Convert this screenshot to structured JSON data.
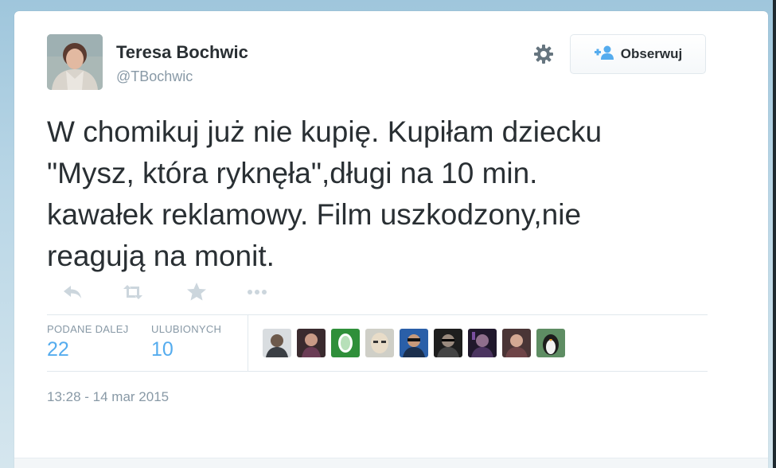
{
  "tweet": {
    "author_name": "Teresa Bochwic",
    "author_handle": "@TBochwic",
    "text_lines": [
      "W chomikuj już nie kupię. Kupiłam dziecku",
      "\"Mysz, która ryknęła\",długi na 10 min.",
      "kawałek reklamowy. Film uszkodzony,nie",
      "reagują na monit."
    ],
    "timestamp": "13:28 - 14 mar 2015"
  },
  "header": {
    "follow_label": "Obserwuj",
    "settings_icon": "gear-icon",
    "follow_icon": "add-user-icon"
  },
  "actions": [
    {
      "icon": "reply-icon"
    },
    {
      "icon": "retweet-icon"
    },
    {
      "icon": "star-icon"
    },
    {
      "icon": "more-icon"
    }
  ],
  "stats": {
    "retweets_label": "PODANE DALEJ",
    "retweets_count": "22",
    "favorites_label": "ULUBIONYCH",
    "favorites_count": "10"
  },
  "favoriters": [
    {
      "name": "user-avatar-1"
    },
    {
      "name": "user-avatar-2"
    },
    {
      "name": "user-avatar-3"
    },
    {
      "name": "user-avatar-4"
    },
    {
      "name": "user-avatar-5"
    },
    {
      "name": "user-avatar-6"
    },
    {
      "name": "user-avatar-7"
    },
    {
      "name": "user-avatar-8"
    },
    {
      "name": "user-avatar-9"
    }
  ],
  "colors": {
    "link_blue": "#55acee",
    "text_dark": "#292f33",
    "text_muted": "#8899a6",
    "border": "#e1e8ed"
  }
}
